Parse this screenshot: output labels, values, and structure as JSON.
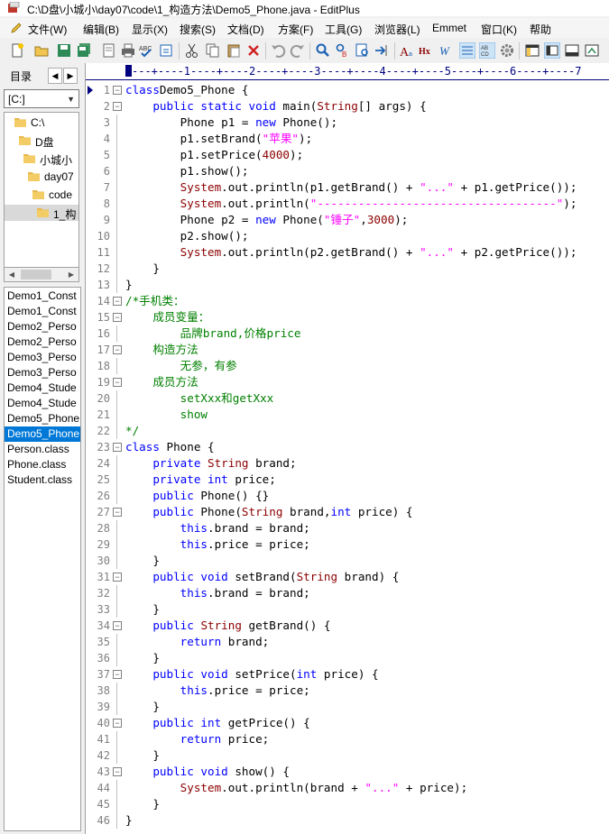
{
  "window": {
    "title": "C:\\D盘\\小城小\\day07\\code\\1_构造方法\\Demo5_Phone.java - EditPlus"
  },
  "menu": [
    {
      "label": "文件(W)",
      "icon": "pencil-icon"
    },
    {
      "label": "编辑(B)"
    },
    {
      "label": "显示(X)"
    },
    {
      "label": "搜索(S)"
    },
    {
      "label": "文档(D)"
    },
    {
      "label": "方案(F)"
    },
    {
      "label": "工具(G)"
    },
    {
      "label": "浏览器(L)"
    },
    {
      "label": "Emmet"
    },
    {
      "label": "窗口(K)"
    },
    {
      "label": "帮助"
    }
  ],
  "sidebar": {
    "tab_label": "目录",
    "drive": "[C:]",
    "tree": [
      {
        "label": "C:\\",
        "level": 0
      },
      {
        "label": "D盘",
        "level": 1
      },
      {
        "label": "小城小",
        "level": 2
      },
      {
        "label": "day07",
        "level": 3
      },
      {
        "label": "code",
        "level": 4
      },
      {
        "label": "1_构",
        "level": 5,
        "selected": true
      }
    ],
    "files": [
      {
        "name": "Demo1_Const"
      },
      {
        "name": "Demo1_Const"
      },
      {
        "name": "Demo2_Perso"
      },
      {
        "name": "Demo2_Perso"
      },
      {
        "name": "Demo3_Perso"
      },
      {
        "name": "Demo3_Perso"
      },
      {
        "name": "Demo4_Stude"
      },
      {
        "name": "Demo4_Stude"
      },
      {
        "name": "Demo5_Phone"
      },
      {
        "name": "Demo5_Phone",
        "selected": true
      },
      {
        "name": "Person.class"
      },
      {
        "name": "Phone.class"
      },
      {
        "name": "Student.class"
      }
    ]
  },
  "editor": {
    "ruler": "---+----1----+----2----+----3----+----4----+----5----+----6----+----7",
    "lines": [
      {
        "n": "1",
        "fold": "⊟",
        "code": [
          [
            "kw",
            "class"
          ],
          [
            "",
            "Demo5_Phone {"
          ]
        ]
      },
      {
        "n": "2",
        "fold": "⊟",
        "code": [
          [
            "",
            "    "
          ],
          [
            "kw",
            "public static void"
          ],
          [
            "",
            " main("
          ],
          [
            "ty",
            "String"
          ],
          [
            "",
            "[] args) {"
          ]
        ]
      },
      {
        "n": "3",
        "code": [
          [
            "",
            "        Phone p1 = "
          ],
          [
            "kw",
            "new"
          ],
          [
            "",
            " Phone();"
          ]
        ]
      },
      {
        "n": "4",
        "code": [
          [
            "",
            "        p1.setBrand("
          ],
          [
            "st",
            "\"苹果\""
          ],
          [
            "",
            ");"
          ]
        ]
      },
      {
        "n": "5",
        "code": [
          [
            "",
            "        p1.setPrice("
          ],
          [
            "nu",
            "4000"
          ],
          [
            "",
            ");"
          ]
        ]
      },
      {
        "n": "6",
        "code": [
          [
            "",
            "        p1.show();"
          ]
        ]
      },
      {
        "n": "7",
        "code": [
          [
            "",
            "        "
          ],
          [
            "ty",
            "System"
          ],
          [
            "",
            ".out.println(p1.getBrand() + "
          ],
          [
            "st",
            "\"...\""
          ],
          [
            "",
            " + p1.getPrice());"
          ]
        ]
      },
      {
        "n": "8",
        "code": [
          [
            "",
            "        "
          ],
          [
            "ty",
            "System"
          ],
          [
            "",
            ".out.println("
          ],
          [
            "st",
            "\"-----------------------------------\""
          ],
          [
            "",
            ");"
          ]
        ]
      },
      {
        "n": "9",
        "code": [
          [
            "",
            "        Phone p2 = "
          ],
          [
            "kw",
            "new"
          ],
          [
            "",
            " Phone("
          ],
          [
            "st",
            "\"锤子\""
          ],
          [
            "",
            ","
          ],
          [
            "nu",
            "3000"
          ],
          [
            "",
            ");"
          ]
        ]
      },
      {
        "n": "10",
        "code": [
          [
            "",
            "        p2.show();"
          ]
        ]
      },
      {
        "n": "11",
        "code": [
          [
            "",
            "        "
          ],
          [
            "ty",
            "System"
          ],
          [
            "",
            ".out.println(p2.getBrand() + "
          ],
          [
            "st",
            "\"...\""
          ],
          [
            "",
            " + p2.getPrice());"
          ]
        ]
      },
      {
        "n": "12",
        "code": [
          [
            "",
            "    }"
          ]
        ]
      },
      {
        "n": "13",
        "code": [
          [
            "",
            "}"
          ]
        ]
      },
      {
        "n": "14",
        "fold": "⊟",
        "code": [
          [
            "cm",
            "/*手机类："
          ]
        ]
      },
      {
        "n": "15",
        "fold": "⊟",
        "code": [
          [
            "cm",
            "    成员变量："
          ]
        ]
      },
      {
        "n": "16",
        "code": [
          [
            "cm",
            "        品牌brand,价格price"
          ]
        ]
      },
      {
        "n": "17",
        "fold": "⊟",
        "code": [
          [
            "cm",
            "    构造方法"
          ]
        ]
      },
      {
        "n": "18",
        "code": [
          [
            "cm",
            "        无参，有参"
          ]
        ]
      },
      {
        "n": "19",
        "fold": "⊟",
        "code": [
          [
            "cm",
            "    成员方法"
          ]
        ]
      },
      {
        "n": "20",
        "code": [
          [
            "cm",
            "        setXxx和getXxx"
          ]
        ]
      },
      {
        "n": "21",
        "code": [
          [
            "cm",
            "        show"
          ]
        ]
      },
      {
        "n": "22",
        "code": [
          [
            "cm",
            "*/"
          ]
        ]
      },
      {
        "n": "23",
        "fold": "⊟",
        "code": [
          [
            "kw",
            "class"
          ],
          [
            "",
            " Phone {"
          ]
        ]
      },
      {
        "n": "24",
        "code": [
          [
            "",
            "    "
          ],
          [
            "kw",
            "private"
          ],
          [
            "",
            " "
          ],
          [
            "ty",
            "String"
          ],
          [
            "",
            " brand;"
          ]
        ]
      },
      {
        "n": "25",
        "code": [
          [
            "",
            "    "
          ],
          [
            "kw",
            "private int"
          ],
          [
            "",
            " price;"
          ]
        ]
      },
      {
        "n": "26",
        "code": [
          [
            "",
            "    "
          ],
          [
            "kw",
            "public"
          ],
          [
            "",
            " Phone() {}"
          ]
        ]
      },
      {
        "n": "27",
        "fold": "⊟",
        "code": [
          [
            "",
            "    "
          ],
          [
            "kw",
            "public"
          ],
          [
            "",
            " Phone("
          ],
          [
            "ty",
            "String"
          ],
          [
            "",
            " brand,"
          ],
          [
            "kw",
            "int"
          ],
          [
            "",
            " price) {"
          ]
        ]
      },
      {
        "n": "28",
        "code": [
          [
            "",
            "        "
          ],
          [
            "kw",
            "this"
          ],
          [
            "",
            ".brand = brand;"
          ]
        ]
      },
      {
        "n": "29",
        "code": [
          [
            "",
            "        "
          ],
          [
            "kw",
            "this"
          ],
          [
            "",
            ".price = price;"
          ]
        ]
      },
      {
        "n": "30",
        "code": [
          [
            "",
            "    }"
          ]
        ]
      },
      {
        "n": "31",
        "fold": "⊟",
        "code": [
          [
            "",
            "    "
          ],
          [
            "kw",
            "public void"
          ],
          [
            "",
            " setBrand("
          ],
          [
            "ty",
            "String"
          ],
          [
            "",
            " brand) {"
          ]
        ]
      },
      {
        "n": "32",
        "code": [
          [
            "",
            "        "
          ],
          [
            "kw",
            "this"
          ],
          [
            "",
            ".brand = brand;"
          ]
        ]
      },
      {
        "n": "33",
        "code": [
          [
            "",
            "    }"
          ]
        ]
      },
      {
        "n": "34",
        "fold": "⊟",
        "code": [
          [
            "",
            "    "
          ],
          [
            "kw",
            "public"
          ],
          [
            "",
            " "
          ],
          [
            "ty",
            "String"
          ],
          [
            "",
            " getBrand() {"
          ]
        ]
      },
      {
        "n": "35",
        "code": [
          [
            "",
            "        "
          ],
          [
            "kw",
            "return"
          ],
          [
            "",
            " brand;"
          ]
        ]
      },
      {
        "n": "36",
        "code": [
          [
            "",
            "    }"
          ]
        ]
      },
      {
        "n": "37",
        "fold": "⊟",
        "code": [
          [
            "",
            "    "
          ],
          [
            "kw",
            "public void"
          ],
          [
            "",
            " setPrice("
          ],
          [
            "kw",
            "int"
          ],
          [
            "",
            " price) {"
          ]
        ]
      },
      {
        "n": "38",
        "code": [
          [
            "",
            "        "
          ],
          [
            "kw",
            "this"
          ],
          [
            "",
            ".price = price;"
          ]
        ]
      },
      {
        "n": "39",
        "code": [
          [
            "",
            "    }"
          ]
        ]
      },
      {
        "n": "40",
        "fold": "⊟",
        "code": [
          [
            "",
            "    "
          ],
          [
            "kw",
            "public int"
          ],
          [
            "",
            " getPrice() {"
          ]
        ]
      },
      {
        "n": "41",
        "code": [
          [
            "",
            "        "
          ],
          [
            "kw",
            "return"
          ],
          [
            "",
            " price;"
          ]
        ]
      },
      {
        "n": "42",
        "code": [
          [
            "",
            "    }"
          ]
        ]
      },
      {
        "n": "43",
        "fold": "⊟",
        "code": [
          [
            "",
            "    "
          ],
          [
            "kw",
            "public void"
          ],
          [
            "",
            " show() {"
          ]
        ]
      },
      {
        "n": "44",
        "code": [
          [
            "",
            "        "
          ],
          [
            "ty",
            "System"
          ],
          [
            "",
            ".out.println(brand + "
          ],
          [
            "st",
            "\"...\""
          ],
          [
            "",
            " + price);"
          ]
        ]
      },
      {
        "n": "45",
        "code": [
          [
            "",
            "    }"
          ]
        ]
      },
      {
        "n": "46",
        "code": [
          [
            "",
            "}"
          ]
        ]
      }
    ]
  },
  "colors": {
    "keyword": "#0000ff",
    "type": "#8b0000",
    "string": "#ff00ff",
    "comment": "#008000",
    "selection": "#0078d7"
  }
}
